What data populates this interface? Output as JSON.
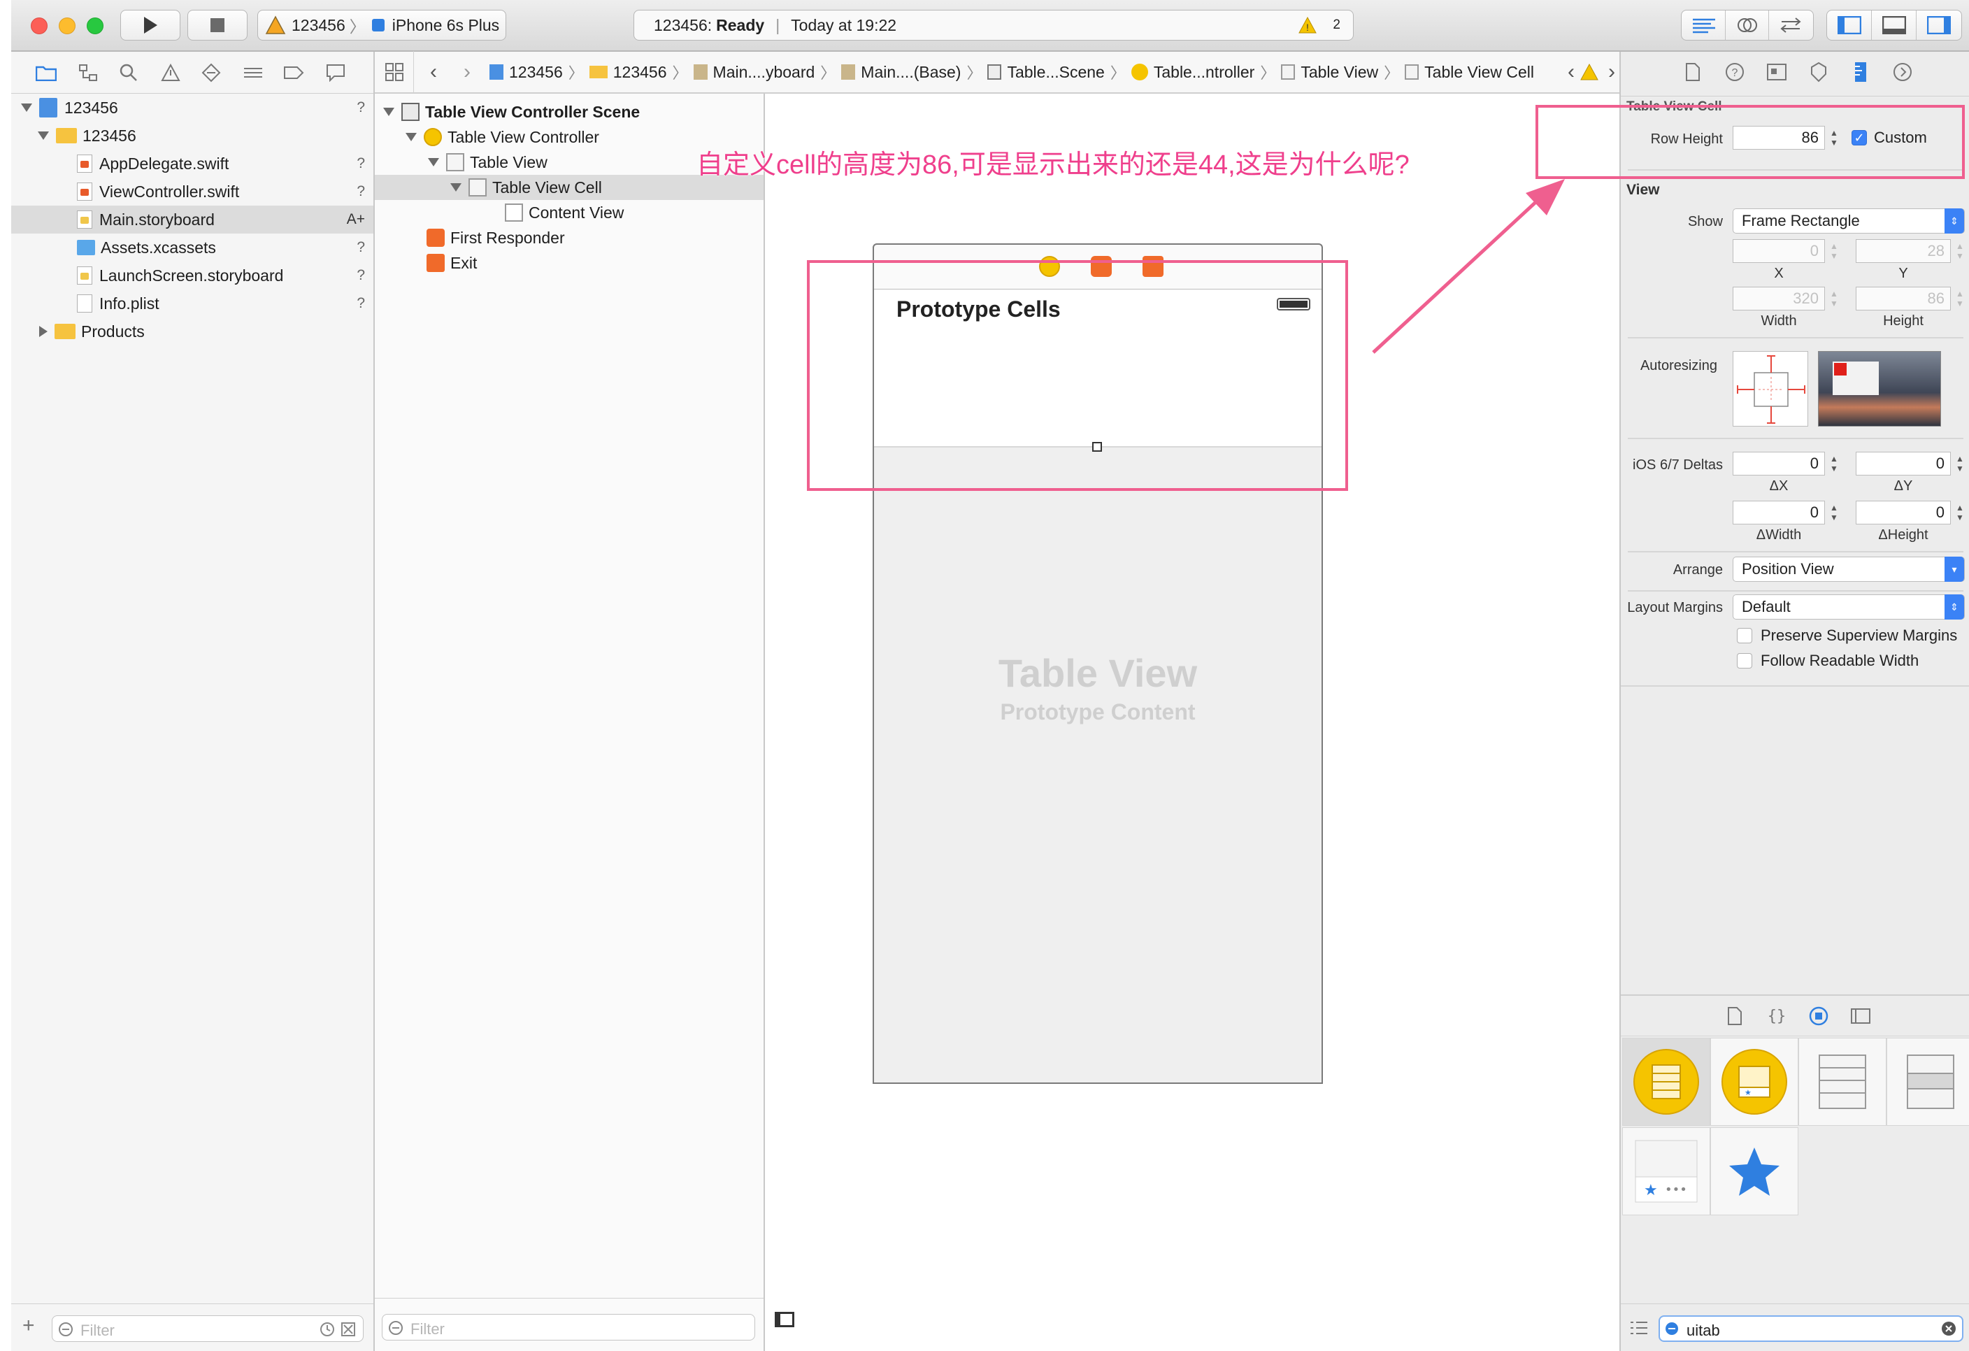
{
  "toolbar": {
    "scheme": "123456",
    "device": "iPhone 6s Plus",
    "status_project": "123456:",
    "status_state": "Ready",
    "status_time": "Today at 19:22",
    "warning_count": "2"
  },
  "navigator": {
    "tree": [
      {
        "label": "123456",
        "status": "?",
        "kind": "project"
      },
      {
        "label": "123456",
        "status": "",
        "kind": "folder"
      },
      {
        "label": "AppDelegate.swift",
        "status": "?",
        "kind": "swift"
      },
      {
        "label": "ViewController.swift",
        "status": "?",
        "kind": "swift"
      },
      {
        "label": "Main.storyboard",
        "status": "A+",
        "kind": "storyboard"
      },
      {
        "label": "Assets.xcassets",
        "status": "?",
        "kind": "assets"
      },
      {
        "label": "LaunchScreen.storyboard",
        "status": "?",
        "kind": "storyboard"
      },
      {
        "label": "Info.plist",
        "status": "?",
        "kind": "plist"
      },
      {
        "label": "Products",
        "status": "",
        "kind": "folder"
      }
    ],
    "filter_placeholder": "Filter"
  },
  "jumpbar": {
    "crumbs": [
      "123456",
      "123456",
      "Main....yboard",
      "Main....(Base)",
      "Table...Scene",
      "Table...ntroller",
      "Table View",
      "Table View Cell"
    ]
  },
  "outline": {
    "rows": [
      {
        "label": "Table View Controller Scene"
      },
      {
        "label": "Table View Controller"
      },
      {
        "label": "Table View"
      },
      {
        "label": "Table View Cell"
      },
      {
        "label": "Content View"
      },
      {
        "label": "First Responder"
      },
      {
        "label": "Exit"
      }
    ],
    "filter_placeholder": "Filter"
  },
  "canvas": {
    "prototype_title": "Prototype Cells",
    "placeholder_title": "Table View",
    "placeholder_subtitle": "Prototype Content"
  },
  "annotation": {
    "text": "自定义cell的高度为86,可是显示出来的还是44,这是为什么呢?",
    "color": "#ef5f8f"
  },
  "inspector": {
    "cell_section": "Table View Cell",
    "row_height_label": "Row Height",
    "row_height_value": "86",
    "custom_label": "Custom",
    "custom_checked": true,
    "view_section": "View",
    "show_label": "Show",
    "show_value": "Frame Rectangle",
    "x_value": "0",
    "y_value": "28",
    "x_label": "X",
    "y_label": "Y",
    "width_value": "320",
    "height_value": "86",
    "width_label": "Width",
    "height_label": "Height",
    "autoresizing_label": "Autoresizing",
    "deltas_label": "iOS 6/7 Deltas",
    "dx_value": "0",
    "dy_value": "0",
    "dx_label": "ΔX",
    "dy_label": "ΔY",
    "dwidth_value": "0",
    "dheight_value": "0",
    "dwidth_label": "ΔWidth",
    "dheight_label": "ΔHeight",
    "arrange_label": "Arrange",
    "arrange_value": "Position View",
    "margins_label": "Layout Margins",
    "margins_value": "Default",
    "preserve_label": "Preserve Superview Margins",
    "readable_label": "Follow Readable Width"
  },
  "library": {
    "search_value": "uitab"
  },
  "colors": {
    "accent": "#3b82f6",
    "warning": "#f5c400",
    "annotation": "#ef5f8f"
  }
}
